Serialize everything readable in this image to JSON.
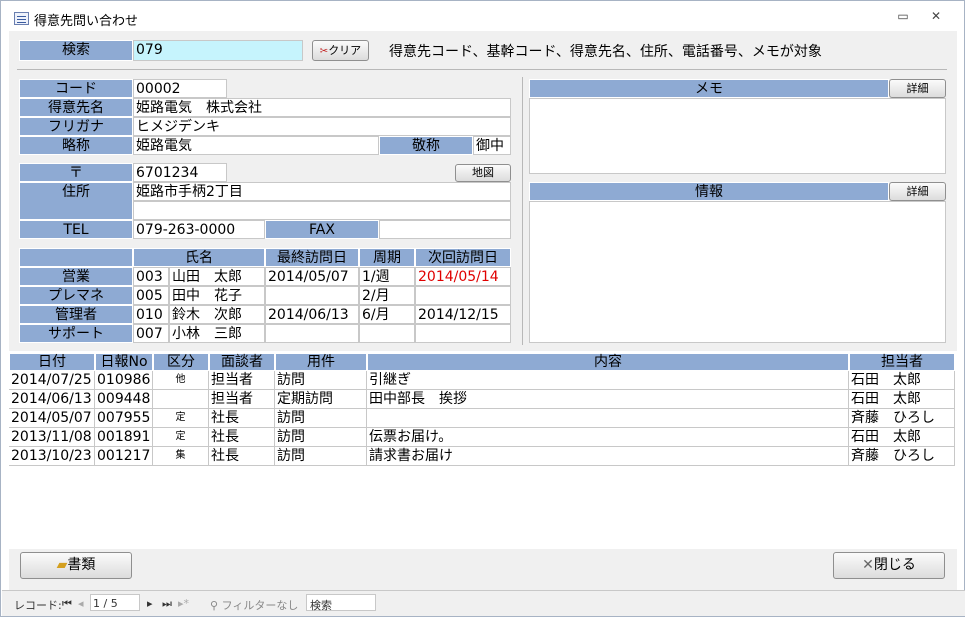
{
  "window": {
    "title": "得意先問い合わせ",
    "minimize": "▭",
    "close": "✕"
  },
  "search": {
    "label": "検索",
    "value": "079",
    "clear_label": "クリア",
    "hint": "得意先コード、基幹コード、得意先名、住所、電話番号、メモが対象"
  },
  "customer": {
    "code_label": "コード",
    "code": "00002",
    "name_label": "得意先名",
    "name": "姫路電気　株式会社",
    "kana_label": "フリガナ",
    "kana": "ヒメジデンキ",
    "short_label": "略称",
    "short": "姫路電気",
    "honorific_label": "敬称",
    "honorific": "御中"
  },
  "address": {
    "zip_label": "〒",
    "zip": "6701234",
    "map_label": "地図",
    "addr_label": "住所",
    "addr": "姫路市手柄2丁目",
    "tel_label": "TEL",
    "tel": "079-263-0000",
    "fax_label": "FAX",
    "fax": ""
  },
  "staff": {
    "headers": [
      "",
      "氏名",
      "最終訪問日",
      "周期",
      "次回訪問日"
    ],
    "rows": [
      {
        "role": "営業",
        "code": "003",
        "name": "山田　太郎",
        "last": "2014/05/07",
        "cycle": "1/週",
        "next": "2014/05/14",
        "next_color": "#e00000"
      },
      {
        "role": "プレマネ",
        "code": "005",
        "name": "田中　花子",
        "last": "",
        "cycle": "2/月",
        "next": "",
        "next_color": "#000000"
      },
      {
        "role": "管理者",
        "code": "010",
        "name": "鈴木　次郎",
        "last": "2014/06/13",
        "cycle": "6/月",
        "next": "2014/12/15",
        "next_color": "#000000"
      },
      {
        "role": "サポート",
        "code": "007",
        "name": "小林　三郎",
        "last": "",
        "cycle": "",
        "next": "",
        "next_color": "#000000"
      }
    ]
  },
  "memo": {
    "label": "メモ",
    "detail_label": "詳細"
  },
  "info": {
    "label": "情報",
    "detail_label": "詳細"
  },
  "visits": {
    "headers": [
      "日付",
      "日報No",
      "区分",
      "面談者",
      "用件",
      "内容",
      "担当者"
    ],
    "rows": [
      {
        "date": "2014/07/25",
        "no": "010986",
        "kubun": "他",
        "person": "担当者",
        "purpose": "訪問",
        "content": "引継ぎ",
        "staff": "石田　太郎"
      },
      {
        "date": "2014/06/13",
        "no": "009448",
        "kubun": "",
        "person": "担当者",
        "purpose": "定期訪問",
        "content": "田中部長　挨拶",
        "staff": "石田　太郎"
      },
      {
        "date": "2014/05/07",
        "no": "007955",
        "kubun": "定",
        "person": "社長",
        "purpose": "訪問",
        "content": "",
        "staff": "斉藤　ひろし"
      },
      {
        "date": "2013/11/08",
        "no": "001891",
        "kubun": "定",
        "person": "社長",
        "purpose": "訪問",
        "content": "伝票お届け。",
        "staff": "石田　太郎"
      },
      {
        "date": "2013/10/23",
        "no": "001217",
        "kubun": "集",
        "person": "社長",
        "purpose": "訪問",
        "content": "請求書お届け",
        "staff": "斉藤　ひろし"
      }
    ]
  },
  "footer": {
    "docs_label": "書類",
    "close_label": "閉じる"
  },
  "statusbar": {
    "record_label": "レコード:",
    "record_value": "1 / 5",
    "filter_label": "フィルターなし",
    "search_label": "検索"
  }
}
